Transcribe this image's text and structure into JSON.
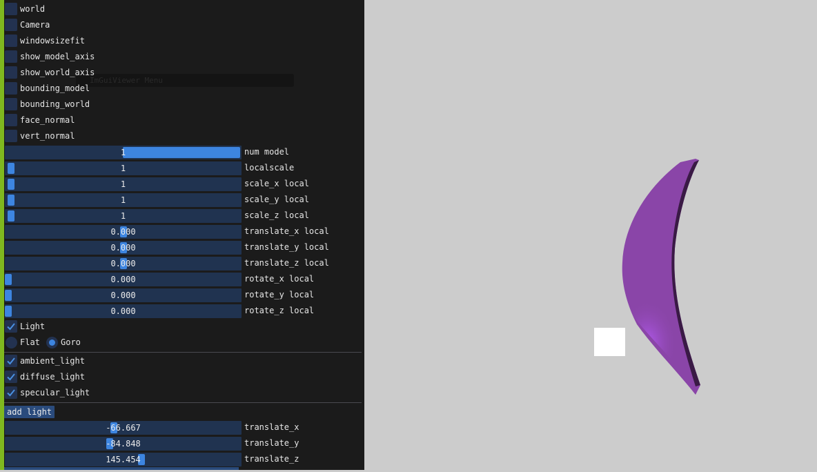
{
  "menu": {
    "ghost_title": "ImGuiViewer Menu",
    "checkboxes": [
      {
        "label": "world",
        "checked": false
      },
      {
        "label": "Camera",
        "checked": false
      },
      {
        "label": "windowsizefit",
        "checked": false
      },
      {
        "label": "show_model_axis",
        "checked": false
      },
      {
        "label": "show_world_axis",
        "checked": false
      },
      {
        "label": "bounding_model",
        "checked": false
      },
      {
        "label": "bounding_world",
        "checked": false
      },
      {
        "label": "face_normal",
        "checked": false
      },
      {
        "label": "vert_normal",
        "checked": false
      }
    ],
    "sliders": [
      {
        "value": "1",
        "label": "num model",
        "fill": 0.5
      },
      {
        "value": "1",
        "label": "localscale",
        "fill": 0.0
      },
      {
        "value": "1",
        "label": "scale_x local",
        "fill": 0.0
      },
      {
        "value": "1",
        "label": "scale_y local",
        "fill": 0.0
      },
      {
        "value": "1",
        "label": "scale_z local",
        "fill": 0.0
      },
      {
        "value": "0.000",
        "label": "translate_x local",
        "fill": 0.5
      },
      {
        "value": "0.000",
        "label": "translate_y local",
        "fill": 0.5
      },
      {
        "value": "0.000",
        "label": "translate_z local",
        "fill": 0.5
      },
      {
        "value": "0.000",
        "label": "rotate_x local",
        "fill": 0.0
      },
      {
        "value": "0.000",
        "label": "rotate_y local",
        "fill": 0.0
      },
      {
        "value": "0.000",
        "label": "rotate_z local",
        "fill": 0.0
      }
    ],
    "light": {
      "label": "Light",
      "checked": true
    },
    "shading": {
      "flat_label": "Flat",
      "goro_label": "Goro",
      "selected": "Goro"
    },
    "light_types": [
      {
        "label": "ambient_light",
        "checked": true
      },
      {
        "label": "diffuse_light",
        "checked": true
      },
      {
        "label": "specular_light",
        "checked": true
      }
    ],
    "add_light_label": "add light",
    "light_sliders": [
      {
        "value": "-66.667",
        "label": "translate_x",
        "fill": 0.46
      },
      {
        "value": "-84.848",
        "label": "translate_y",
        "fill": 0.44
      },
      {
        "value": "145.454",
        "label": "translate_z",
        "fill": 0.58
      }
    ]
  },
  "colors": {
    "viewport_bg": "#cccccc",
    "model": "#8a45a8",
    "accent": "#3d85e0",
    "light_marker": "#ffffff"
  }
}
